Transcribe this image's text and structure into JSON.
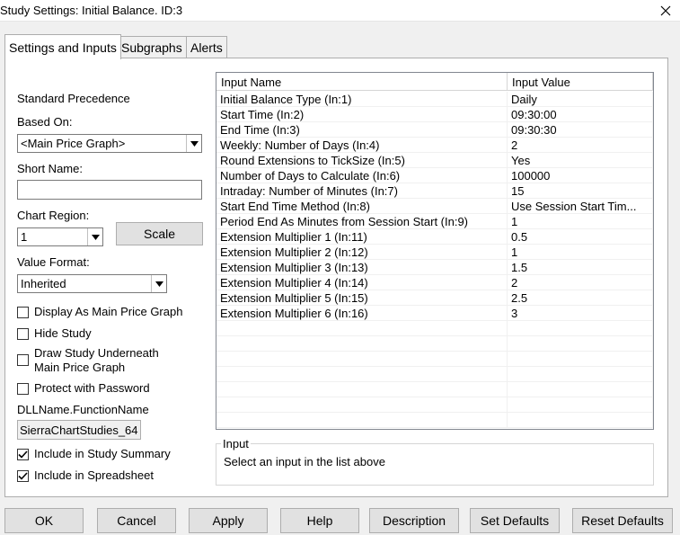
{
  "window": {
    "title": "Study Settings: Initial Balance. ID:3"
  },
  "tabs": [
    {
      "label": "Settings and Inputs",
      "active": true
    },
    {
      "label": "Subgraphs",
      "active": false
    },
    {
      "label": "Alerts",
      "active": false
    }
  ],
  "left": {
    "standard_precedence": "Standard Precedence",
    "based_on_label": "Based On:",
    "based_on_value": "<Main Price Graph>",
    "short_name_label": "Short Name:",
    "short_name_value": "",
    "chart_region_label": "Chart Region:",
    "chart_region_value": "1",
    "scale_button": "Scale",
    "value_format_label": "Value Format:",
    "value_format_value": "Inherited",
    "checkboxes": [
      {
        "label": "Display As Main Price Graph",
        "checked": false
      },
      {
        "label": "Hide Study",
        "checked": false
      },
      {
        "label": "Draw Study Underneath Main Price Graph",
        "checked": false
      },
      {
        "label": "Protect with Password",
        "checked": false
      }
    ],
    "dll_label": "DLLName.FunctionName",
    "dll_value": "SierraChartStudies_64",
    "checkboxes2": [
      {
        "label": "Include in Study Summary",
        "checked": true
      },
      {
        "label": "Include in Spreadsheet",
        "checked": true
      }
    ]
  },
  "inputs_table": {
    "columns": [
      "Input Name",
      "Input Value"
    ],
    "rows": [
      {
        "name": "Initial Balance Type   (In:1)",
        "value": "Daily"
      },
      {
        "name": "Start Time   (In:2)",
        "value": "09:30:00"
      },
      {
        "name": "End Time   (In:3)",
        "value": "09:30:30"
      },
      {
        "name": "Weekly: Number of Days   (In:4)",
        "value": "2"
      },
      {
        "name": "Round Extensions to TickSize   (In:5)",
        "value": "Yes"
      },
      {
        "name": "Number of Days to Calculate   (In:6)",
        "value": "100000"
      },
      {
        "name": "Intraday: Number of Minutes   (In:7)",
        "value": "15"
      },
      {
        "name": "Start End Time Method   (In:8)",
        "value": "Use Session Start Tim..."
      },
      {
        "name": "Period End As Minutes from Session Start   (In:9)",
        "value": "1"
      },
      {
        "name": "Extension Multiplier 1   (In:11)",
        "value": "0.5"
      },
      {
        "name": "Extension Multiplier 2   (In:12)",
        "value": "1"
      },
      {
        "name": "Extension Multiplier 3   (In:13)",
        "value": "1.5"
      },
      {
        "name": "Extension Multiplier 4   (In:14)",
        "value": "2"
      },
      {
        "name": "Extension Multiplier 5   (In:15)",
        "value": "2.5"
      },
      {
        "name": "Extension Multiplier 6   (In:16)",
        "value": "3"
      }
    ]
  },
  "input_group": {
    "title": "Input",
    "description": "Select an input in the list above"
  },
  "buttons": {
    "ok": "OK",
    "cancel": "Cancel",
    "apply": "Apply",
    "help": "Help",
    "description": "Description",
    "set_defaults": "Set Defaults",
    "reset_defaults": "Reset Defaults"
  },
  "icons": {
    "close": "close-icon",
    "dropdown": "chevron-down-icon",
    "check": "check-icon"
  }
}
